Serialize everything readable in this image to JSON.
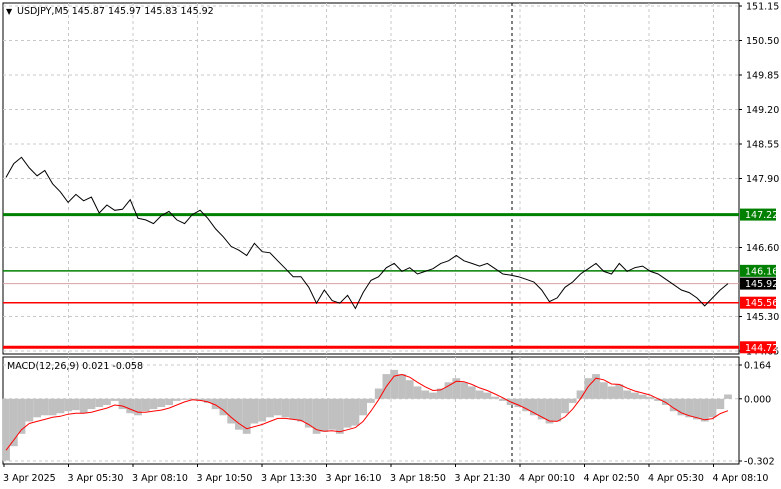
{
  "symbol_header": {
    "arrow": "▼",
    "text": "USDJPY,M5  145.87 145.97 145.83 145.92"
  },
  "macd_header": {
    "text": "MACD(12,26,9) 0.021 -0.058"
  },
  "colors": {
    "background": "#ffffff",
    "grid": "#c8c8c8",
    "price_line": "#000000",
    "support_line": "#ff0000",
    "resistance_line": "#008000",
    "histogram": "#c0c0c0",
    "signal_line": "#ff0000",
    "current_price_box": "#000000"
  },
  "chart_data": [
    {
      "type": "line",
      "title": "USDJPY,M5",
      "ylim": [
        144.72,
        151.15
      ],
      "y_ticks": [
        "151.15",
        "150.50",
        "149.85",
        "149.20",
        "148.55",
        "147.90",
        "146.60",
        "145.30",
        "144.65"
      ],
      "x_ticks": [
        "3 Apr 2025",
        "3 Apr 05:30",
        "3 Apr 08:10",
        "3 Apr 10:50",
        "3 Apr 13:30",
        "3 Apr 16:10",
        "3 Apr 18:50",
        "3 Apr 21:30",
        "4 Apr 00:10",
        "4 Apr 02:50",
        "4 Apr 05:30",
        "4 Apr 08:10"
      ],
      "day_separator": "4 Apr 00:00",
      "horizontal_levels": [
        {
          "label": "147.22",
          "value": 147.22,
          "color": "#008000"
        },
        {
          "label": "146.16",
          "value": 146.16,
          "color": "#008000"
        },
        {
          "label": "145.56",
          "value": 145.56,
          "color": "#ff0000"
        },
        {
          "label": "144.72",
          "value": 144.72,
          "color": "#ff0000"
        }
      ],
      "current_price": {
        "label": "145.92",
        "value": 145.92
      },
      "series": [
        {
          "values": [
            147.92,
            148.18,
            148.3,
            148.1,
            147.95,
            148.05,
            147.8,
            147.65,
            147.45,
            147.6,
            147.48,
            147.55,
            147.25,
            147.4,
            147.3,
            147.32,
            147.5,
            147.15,
            147.12,
            147.05,
            147.2,
            147.28,
            147.12,
            147.05,
            147.22,
            147.3,
            147.15,
            146.95,
            146.8,
            146.62,
            146.55,
            146.45,
            146.68,
            146.52,
            146.5,
            146.35,
            146.2,
            146.05,
            146.05,
            145.85,
            145.55,
            145.8,
            145.6,
            145.55,
            145.7,
            145.45,
            145.75,
            145.98,
            146.05,
            146.22,
            146.3,
            146.15,
            146.22,
            146.1,
            146.15,
            146.2,
            146.3,
            146.35,
            146.45,
            146.35,
            146.3,
            146.25,
            146.3,
            146.2,
            146.1,
            146.08,
            146.05,
            146.0,
            145.95,
            145.8,
            145.58,
            145.65,
            145.85,
            145.95,
            146.1,
            146.2,
            146.3,
            146.15,
            146.1,
            146.3,
            146.15,
            146.22,
            146.25,
            146.15,
            146.1,
            146.0,
            145.9,
            145.8,
            145.75,
            145.65,
            145.5,
            145.65,
            145.8,
            145.92
          ]
        }
      ]
    },
    {
      "type": "bar",
      "title": "MACD(12,26,9)",
      "ylim": [
        -0.302,
        0.164
      ],
      "y_ticks": [
        "0.164",
        "0.000",
        "-0.302"
      ],
      "series": [
        {
          "name": "MACD",
          "values": [
            -0.3,
            -0.23,
            -0.17,
            -0.11,
            -0.09,
            -0.08,
            -0.08,
            -0.07,
            -0.06,
            -0.055,
            -0.07,
            -0.05,
            -0.04,
            -0.03,
            -0.01,
            -0.05,
            -0.07,
            -0.08,
            -0.06,
            -0.05,
            -0.04,
            -0.03,
            -0.01,
            -0.005,
            0.0,
            -0.01,
            -0.02,
            -0.05,
            -0.08,
            -0.12,
            -0.15,
            -0.17,
            -0.12,
            -0.11,
            -0.09,
            -0.08,
            -0.09,
            -0.1,
            -0.11,
            -0.14,
            -0.17,
            -0.16,
            -0.15,
            -0.17,
            -0.14,
            -0.13,
            -0.08,
            -0.02,
            0.05,
            0.12,
            0.14,
            0.12,
            0.09,
            0.06,
            0.04,
            0.03,
            0.05,
            0.08,
            0.1,
            0.08,
            0.06,
            0.04,
            0.03,
            0.01,
            -0.01,
            -0.03,
            -0.04,
            -0.06,
            -0.08,
            -0.1,
            -0.12,
            -0.11,
            -0.07,
            -0.02,
            0.04,
            0.1,
            0.12,
            0.08,
            0.06,
            0.07,
            0.04,
            0.03,
            0.02,
            0.01,
            -0.01,
            -0.03,
            -0.06,
            -0.08,
            -0.09,
            -0.1,
            -0.11,
            -0.09,
            -0.05,
            0.021
          ]
        },
        {
          "name": "Signal",
          "values": [
            -0.25,
            -0.2,
            -0.15,
            -0.12,
            -0.11,
            -0.1,
            -0.09,
            -0.085,
            -0.075,
            -0.07,
            -0.07,
            -0.065,
            -0.055,
            -0.045,
            -0.03,
            -0.035,
            -0.05,
            -0.065,
            -0.065,
            -0.06,
            -0.055,
            -0.045,
            -0.03,
            -0.015,
            -0.005,
            -0.008,
            -0.015,
            -0.03,
            -0.055,
            -0.09,
            -0.12,
            -0.145,
            -0.135,
            -0.125,
            -0.11,
            -0.095,
            -0.095,
            -0.1,
            -0.105,
            -0.125,
            -0.15,
            -0.158,
            -0.155,
            -0.16,
            -0.15,
            -0.14,
            -0.11,
            -0.06,
            -0.005,
            0.06,
            0.11,
            0.118,
            0.105,
            0.08,
            0.058,
            0.04,
            0.043,
            0.063,
            0.085,
            0.083,
            0.07,
            0.053,
            0.04,
            0.023,
            0.005,
            -0.015,
            -0.03,
            -0.048,
            -0.068,
            -0.088,
            -0.108,
            -0.11,
            -0.088,
            -0.05,
            0.0,
            0.06,
            0.1,
            0.092,
            0.072,
            0.07,
            0.052,
            0.038,
            0.028,
            0.018,
            0.0,
            -0.018,
            -0.045,
            -0.068,
            -0.082,
            -0.092,
            -0.102,
            -0.096,
            -0.072,
            -0.058
          ]
        }
      ]
    }
  ]
}
